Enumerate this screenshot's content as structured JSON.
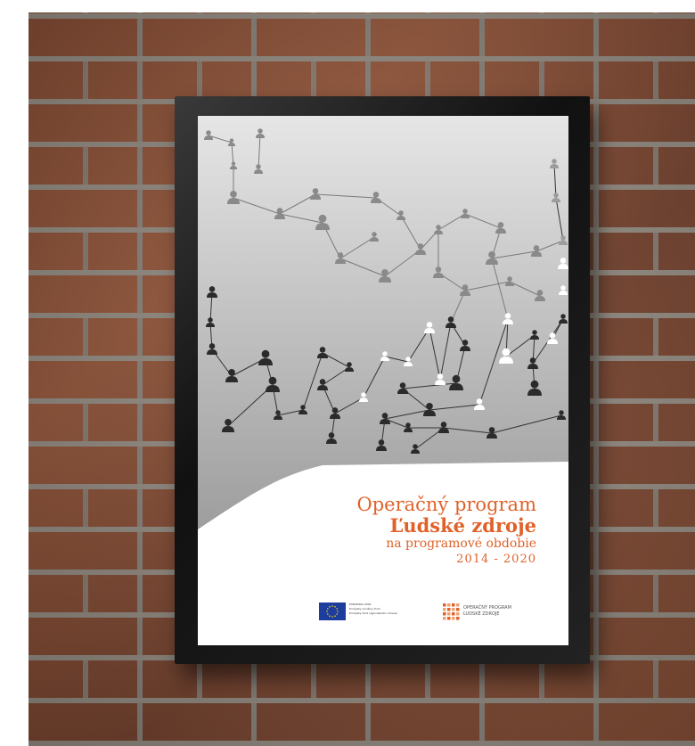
{
  "poster": {
    "title_line1": "Operačný program",
    "title_line2": "Ľudské zdroje",
    "title_line3": "na programové obdobie",
    "title_line4": "2014 - 2020",
    "eu_logo_text": [
      "EURÓPSKA ÚNIA",
      "Európsky sociálny fond",
      "Európsky fond regionálneho rozvoja"
    ],
    "op_logo_text": [
      "OPERAČNÝ PROGRAM",
      "ĽUDSKÉ ZDROJE"
    ],
    "accent_color": "#e0622a"
  }
}
